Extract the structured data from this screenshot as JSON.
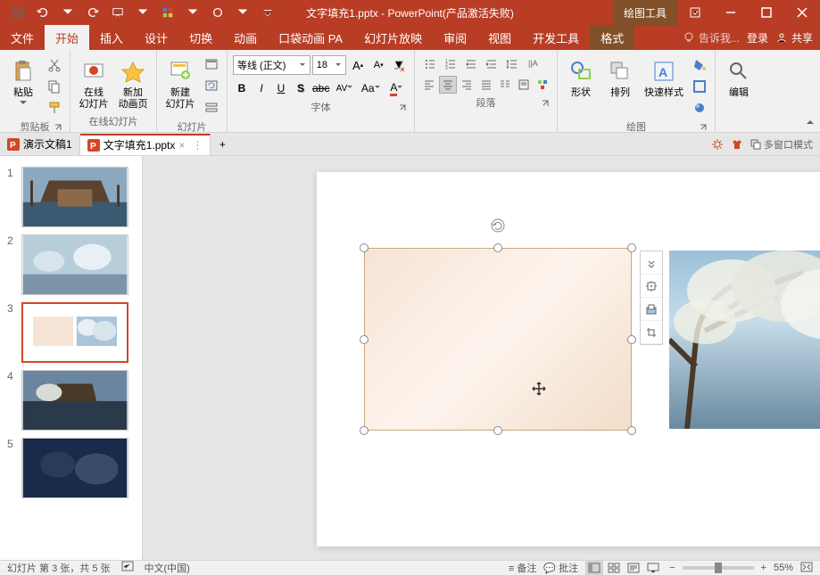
{
  "titlebar": {
    "document_title": "文字填充1.pptx - PowerPoint(产品激活失败)",
    "context_tab": "绘图工具"
  },
  "menubar": {
    "items": [
      "文件",
      "开始",
      "插入",
      "设计",
      "切换",
      "动画",
      "口袋动画 PA",
      "幻灯片放映",
      "审阅",
      "视图",
      "开发工具",
      "格式"
    ],
    "tell_me": "告诉我...",
    "login": "登录",
    "share": "共享"
  },
  "ribbon": {
    "clipboard": {
      "label": "剪贴板",
      "paste": "粘贴"
    },
    "slides": {
      "label": "幻灯片",
      "online": "在线\n幻灯片",
      "new_anim": "新加\n动画页",
      "new_slide": "新建\n幻灯片",
      "online_label": "在线幻灯片"
    },
    "font": {
      "label": "字体",
      "font_name": "等线 (正文)",
      "font_size": "18"
    },
    "paragraph": {
      "label": "段落"
    },
    "drawing": {
      "label": "绘图",
      "shapes": "形状",
      "arrange": "排列",
      "quick_styles": "快速样式"
    },
    "editing": {
      "label": "编辑",
      "find": "编辑"
    }
  },
  "doc_tabs": {
    "tabs": [
      {
        "name": "演示文稿1",
        "active": false
      },
      {
        "name": "文字填充1.pptx",
        "active": true
      }
    ],
    "multi_window": "多窗口模式"
  },
  "slides_panel": {
    "count": 5,
    "selected": 3
  },
  "statusbar": {
    "slide_info": "幻灯片 第 3 张，共 5 张",
    "language": "中文(中国)",
    "notes": "备注",
    "comments": "批注",
    "zoom": "55%"
  },
  "chart_data": null
}
